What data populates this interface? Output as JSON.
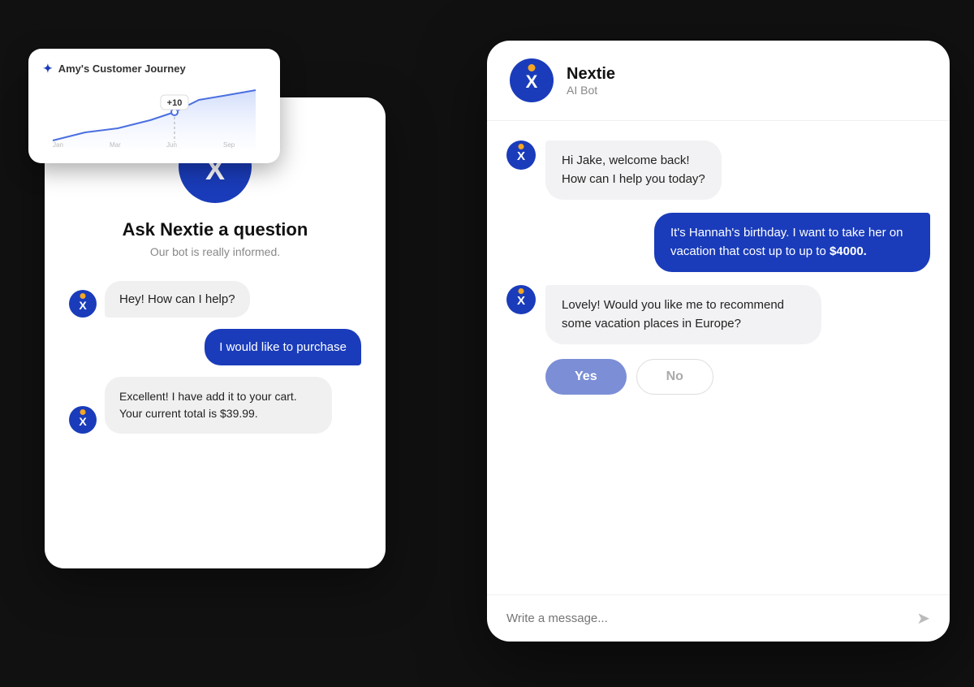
{
  "scene": {
    "background": "#111"
  },
  "journey_card": {
    "title": "Amy's Customer Journey",
    "tooltip": "+10",
    "sparkle": "✦"
  },
  "back_card": {
    "logo_letter": "X",
    "ask_title": "Ask Nextie a question",
    "ask_subtitle": "Our bot is really informed.",
    "messages": [
      {
        "role": "bot",
        "text": "Hey! How can I help?"
      },
      {
        "role": "user",
        "text": "I would like to purchase"
      },
      {
        "role": "bot",
        "text": "Excellent! I have add it to your cart. Your current total is $39.99."
      }
    ]
  },
  "front_card": {
    "header": {
      "bot_name": "Nextie",
      "bot_type": "AI Bot",
      "logo_letter": "X"
    },
    "messages": [
      {
        "id": 1,
        "role": "bot",
        "text": "Hi Jake, welcome back!\nHow can I help you today?"
      },
      {
        "id": 2,
        "role": "user",
        "text": "It's Hannah's birthday. I want to take her on vacation that cost up to up to $4000."
      },
      {
        "id": 3,
        "role": "bot",
        "text": "Lovely! Would you like me to recommend some vacation places in Europe?"
      },
      {
        "id": 4,
        "role": "buttons",
        "yes": "Yes",
        "no": "No"
      }
    ],
    "input_placeholder": "Write a message...",
    "send_icon": "➤"
  }
}
